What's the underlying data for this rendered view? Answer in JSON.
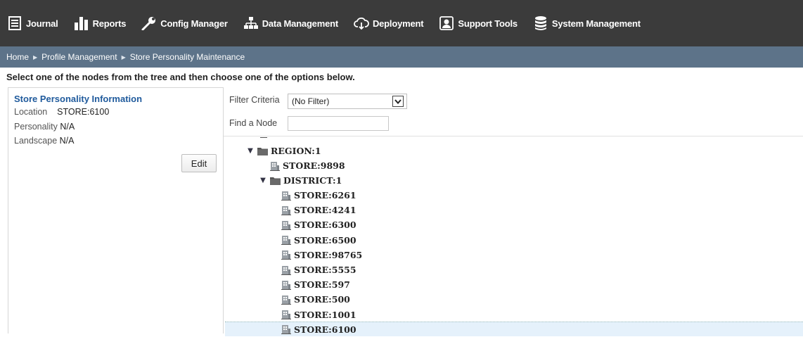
{
  "nav": {
    "items": [
      {
        "label": "Journal",
        "icon": "journal-icon"
      },
      {
        "label": "Reports",
        "icon": "bar-chart-icon"
      },
      {
        "label": "Config Manager",
        "icon": "wrench-icon"
      },
      {
        "label": "Data Management",
        "icon": "hierarchy-icon"
      },
      {
        "label": "Deployment",
        "icon": "cloud-download-icon"
      },
      {
        "label": "Support Tools",
        "icon": "support-user-icon"
      },
      {
        "label": "System Management",
        "icon": "database-icon"
      }
    ]
  },
  "breadcrumb": {
    "items": [
      "Home",
      "Profile Management"
    ],
    "current": "Store Personality Maintenance",
    "separator": "▶"
  },
  "instructions": "Select one of the nodes from the tree and then choose one of the options below.",
  "info": {
    "title": "Store Personality Information",
    "location_label": "Location",
    "location_value": "STORE:6100",
    "personality_label": "Personality",
    "personality_value": "N/A",
    "landscape_label": "Landscape",
    "landscape_value": "N/A",
    "edit_label": "Edit"
  },
  "filter": {
    "label": "Filter Criteria",
    "selected": "(No Filter)"
  },
  "find": {
    "label": "Find a Node",
    "value": ""
  },
  "tree": {
    "region": "REGION:1",
    "region_store": "STORE:9898",
    "district": "DISTRICT:1",
    "stores": [
      "STORE:6261",
      "STORE:4241",
      "STORE:6300",
      "STORE:6500",
      "STORE:98765",
      "STORE:5555",
      "STORE:597",
      "STORE:500",
      "STORE:1001",
      "STORE:6100"
    ],
    "selected": "STORE:6100"
  },
  "colors": {
    "nav_bg": "#3b3b3b",
    "breadcrumb_bg": "#5d7389",
    "info_title": "#1f5a9c",
    "selected_row": "#e5f1fb"
  }
}
